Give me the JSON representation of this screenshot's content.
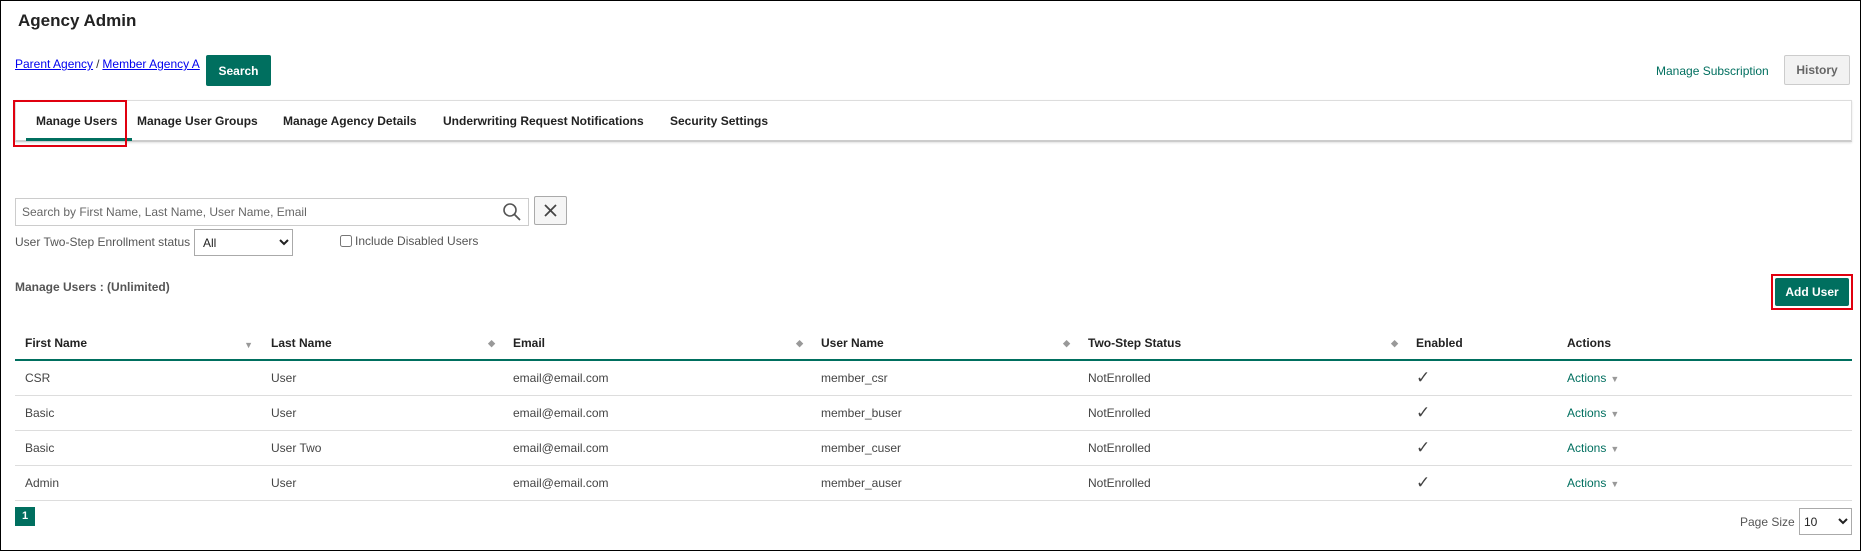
{
  "page": {
    "title": "Agency Admin"
  },
  "breadcrumb": {
    "parent": "Parent Agency",
    "separator": "/",
    "member": "Member Agency A"
  },
  "top_actions": {
    "search_label": "Search",
    "manage_subscription": "Manage Subscription",
    "history_label": "History"
  },
  "tabs": [
    {
      "label": "Manage Users",
      "active": true
    },
    {
      "label": "Manage User Groups",
      "active": false
    },
    {
      "label": "Manage Agency Details",
      "active": false
    },
    {
      "label": "Underwriting Request Notifications",
      "active": false
    },
    {
      "label": "Security Settings",
      "active": false
    }
  ],
  "filters": {
    "search_placeholder": "Search by First Name, Last Name, User Name, Email",
    "search_value": "",
    "enrollment_label": "User Two-Step Enrollment status",
    "enrollment_selected": "All",
    "include_disabled_label": "Include Disabled Users",
    "include_disabled_checked": false
  },
  "section": {
    "title": "Manage Users : (Unlimited)",
    "add_user_label": "Add User"
  },
  "table": {
    "columns": [
      "First Name",
      "Last Name",
      "Email",
      "User Name",
      "Two-Step Status",
      "Enabled",
      "Actions"
    ],
    "rows": [
      {
        "first": "CSR",
        "last": "User",
        "email": "email@email.com",
        "username": "member_csr",
        "twostep": "NotEnrolled",
        "enabled": "✓",
        "actions": "Actions"
      },
      {
        "first": "Basic",
        "last": "User",
        "email": "email@email.com",
        "username": "member_buser",
        "twostep": "NotEnrolled",
        "enabled": "✓",
        "actions": "Actions"
      },
      {
        "first": "Basic",
        "last": "User Two",
        "email": "email@email.com",
        "username": "member_cuser",
        "twostep": "NotEnrolled",
        "enabled": "✓",
        "actions": "Actions"
      },
      {
        "first": "Admin",
        "last": "User",
        "email": "email@email.com",
        "username": "member_auser",
        "twostep": "NotEnrolled",
        "enabled": "✓",
        "actions": "Actions"
      }
    ]
  },
  "pagination": {
    "current_page": "1",
    "page_size_label": "Page Size",
    "page_size": "10"
  },
  "colors": {
    "accent": "#006f5f",
    "highlight": "#e0000f",
    "check": "#1e8c2e"
  },
  "icons": {
    "search": "search-icon",
    "clear": "close-icon",
    "sort": "sort-icon",
    "dropdown": "chevron-down-icon"
  }
}
